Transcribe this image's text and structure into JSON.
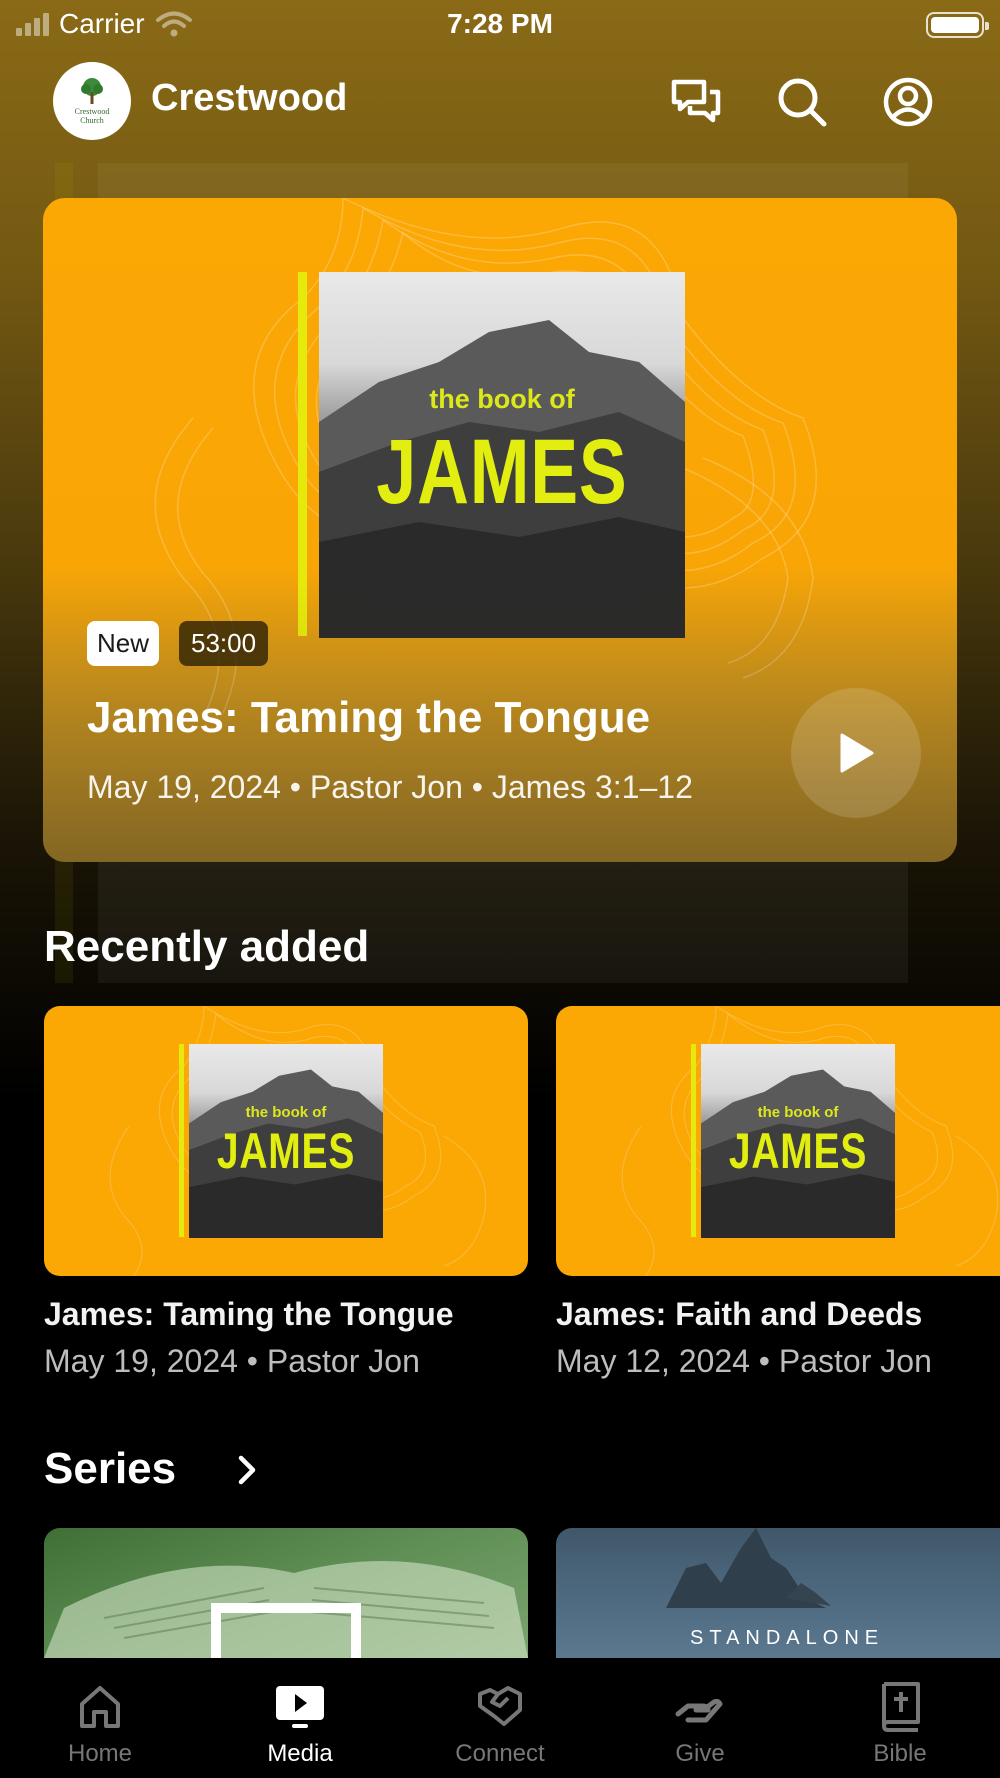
{
  "status_bar": {
    "carrier": "Carrier",
    "time": "7:28 PM"
  },
  "header": {
    "brand": "Crestwood",
    "logo_text_line1": "Crestwood",
    "logo_text_line2": "Church"
  },
  "featured": {
    "badge_new": "New",
    "duration": "53:00",
    "title": "James: Taming the Tongue",
    "meta": "May 19, 2024 • Pastor Jon • James 3:1–12",
    "art_small": "the book of",
    "art_big": "JAMES"
  },
  "recent": {
    "heading": "Recently added",
    "items": [
      {
        "title": "James: Taming the Tongue",
        "meta": "May 19, 2024 • Pastor Jon"
      },
      {
        "title": "James: Faith and Deeds",
        "meta": "May 12, 2024 • Pastor Jon"
      }
    ]
  },
  "series": {
    "heading": "Series",
    "items": [
      {
        "label": ""
      },
      {
        "label": "STANDALONE"
      }
    ]
  },
  "tabs": [
    {
      "label": "Home",
      "icon": "home-icon",
      "active": false
    },
    {
      "label": "Media",
      "icon": "media-icon",
      "active": true
    },
    {
      "label": "Connect",
      "icon": "connect-icon",
      "active": false
    },
    {
      "label": "Give",
      "icon": "give-icon",
      "active": false
    },
    {
      "label": "Bible",
      "icon": "bible-icon",
      "active": false
    }
  ],
  "colors": {
    "accent_orange": "#fba704",
    "art_yellow": "#e1ee10",
    "tab_inactive": "#777777",
    "tab_active": "#ffffff"
  }
}
